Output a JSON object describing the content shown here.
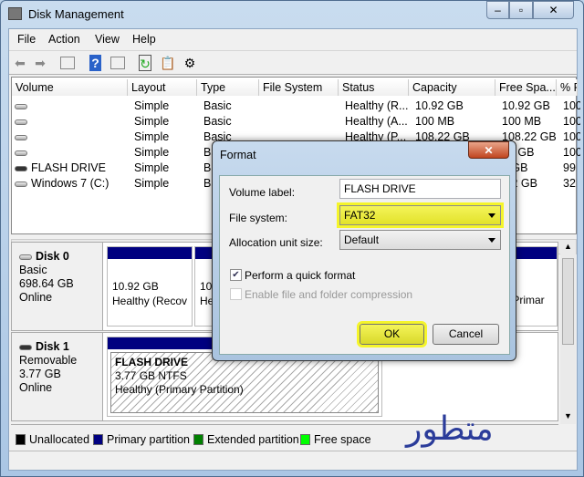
{
  "window": {
    "title": "Disk Management",
    "minimize": "‒",
    "maximize": "▫",
    "close": "✕"
  },
  "menu": [
    "File",
    "Action",
    "View",
    "Help"
  ],
  "toolbar": {
    "icons": [
      "back-icon",
      "forward-icon",
      "console-tree-icon",
      "help-icon",
      "action-pane-icon",
      "refresh-icon",
      "properties-icon",
      "settings-icon"
    ]
  },
  "list": {
    "columns": [
      "Volume",
      "Layout",
      "Type",
      "File System",
      "Status",
      "Capacity",
      "Free Spa...",
      "% F"
    ],
    "rows": [
      [
        "",
        "Simple",
        "Basic",
        "",
        "Healthy (R...",
        "10.92 GB",
        "10.92 GB",
        "100"
      ],
      [
        "",
        "Simple",
        "Basic",
        "",
        "Healthy (A...",
        "100 MB",
        "100 MB",
        "100"
      ],
      [
        "",
        "Simple",
        "Basic",
        "",
        "Healthy (P...",
        "108.22 GB",
        "108.22 GB",
        "100"
      ],
      [
        "",
        "Simple",
        "Ba",
        "",
        "",
        "",
        "00 GB",
        "100"
      ],
      [
        "FLASH DRIVE",
        "Simple",
        "Ba",
        "",
        "",
        "",
        "2 GB",
        "99"
      ],
      [
        "Windows 7 (C:)",
        "Simple",
        "Ba",
        "",
        "",
        "",
        ".42 GB",
        "32"
      ]
    ]
  },
  "disks": [
    {
      "name": "Disk 0",
      "type": "Basic",
      "size": "698.64 GB",
      "state": "Online",
      "partitions": [
        {
          "size": "10.92 GB",
          "status": "Healthy (Recov"
        },
        {
          "size": "10",
          "status": "He"
        },
        {
          "size": "",
          "status": "/Primar"
        }
      ]
    },
    {
      "name": "Disk 1",
      "type": "Removable",
      "size": "3.77 GB",
      "state": "Online",
      "partitions": [
        {
          "name": "FLASH DRIVE",
          "size": "3.77 GB NTFS",
          "status": "Healthy (Primary Partition)"
        }
      ]
    }
  ],
  "legend": [
    {
      "label": "Unallocated",
      "color": "#000000"
    },
    {
      "label": "Primary partition",
      "color": "#000080"
    },
    {
      "label": "Extended partition",
      "color": "#008000"
    },
    {
      "label": "Free space",
      "color": "#00ff00"
    }
  ],
  "dialog": {
    "title": "Format",
    "close": "✕",
    "volume_label": "Volume label:",
    "volume_value": "FLASH DRIVE",
    "fs_label": "File system:",
    "fs_value": "FAT32",
    "alloc_label": "Allocation unit size:",
    "alloc_value": "Default",
    "quick_format": "Perform a quick format",
    "quick_checked": true,
    "compression": "Enable file and folder compression",
    "ok": "OK",
    "cancel": "Cancel",
    "highlight": "#f5f52a"
  },
  "watermark": "متطور"
}
